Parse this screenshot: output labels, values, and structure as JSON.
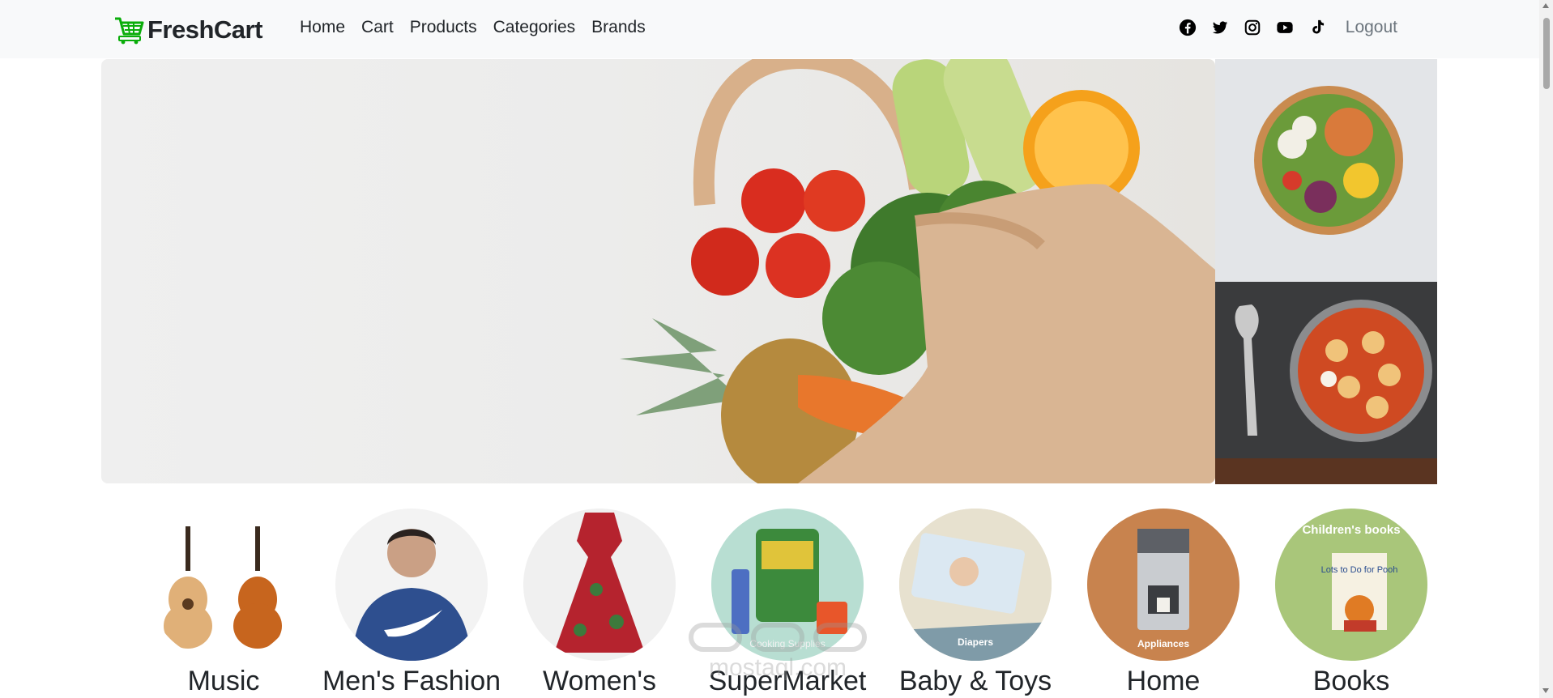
{
  "brand": {
    "name": "FreshCart"
  },
  "nav": {
    "links": [
      "Home",
      "Cart",
      "Products",
      "Categories",
      "Brands"
    ],
    "social_icons": [
      "facebook-icon",
      "twitter-icon",
      "instagram-icon",
      "youtube-icon",
      "tiktok-icon"
    ],
    "logout": "Logout"
  },
  "categories": [
    {
      "name": "Music"
    },
    {
      "name": "Men's Fashion"
    },
    {
      "name": "Women's"
    },
    {
      "name": "SuperMarket",
      "image_caption": "Cooking Supplies"
    },
    {
      "name": "Baby & Toys",
      "image_caption": "Diapers"
    },
    {
      "name": "Home",
      "image_caption": "Appliances"
    },
    {
      "name": "Books",
      "image_caption": "Children's books",
      "book_title": "Lots to Do for Pooh"
    }
  ],
  "watermark": "mostaql.com",
  "colors": {
    "brand_green": "#0aad0a",
    "text": "#212529",
    "muted": "#6c757d",
    "navbar_bg": "#f8f9fa"
  }
}
